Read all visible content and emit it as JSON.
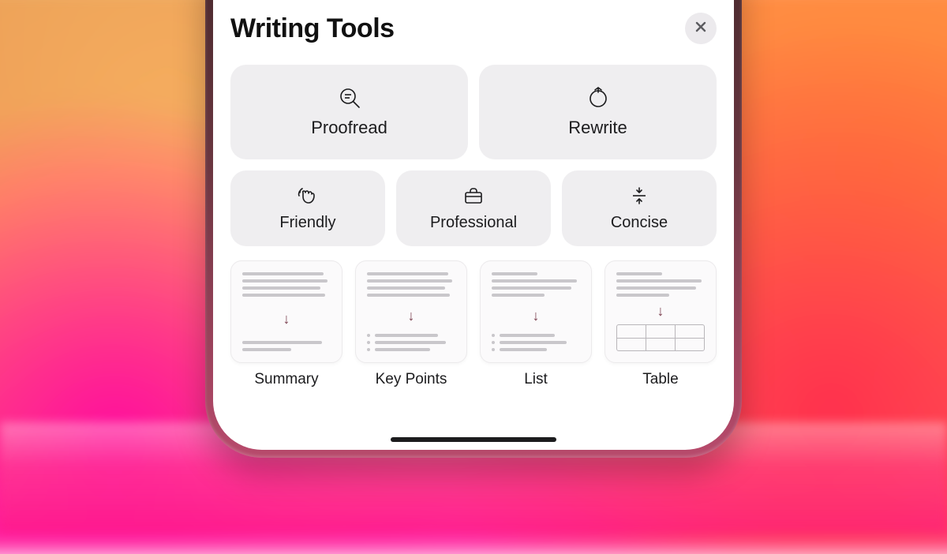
{
  "sheet": {
    "title": "Writing Tools",
    "close_icon": "close"
  },
  "actions": {
    "proofread": {
      "label": "Proofread",
      "icon": "magnifier-text"
    },
    "rewrite": {
      "label": "Rewrite",
      "icon": "arrow-clockwise-circle"
    }
  },
  "tones": {
    "friendly": {
      "label": "Friendly",
      "icon": "hand-wave"
    },
    "professional": {
      "label": "Professional",
      "icon": "briefcase"
    },
    "concise": {
      "label": "Concise",
      "icon": "compress-lines"
    }
  },
  "formats": {
    "summary": {
      "label": "Summary"
    },
    "keypoints": {
      "label": "Key Points"
    },
    "list": {
      "label": "List"
    },
    "table": {
      "label": "Table"
    }
  }
}
